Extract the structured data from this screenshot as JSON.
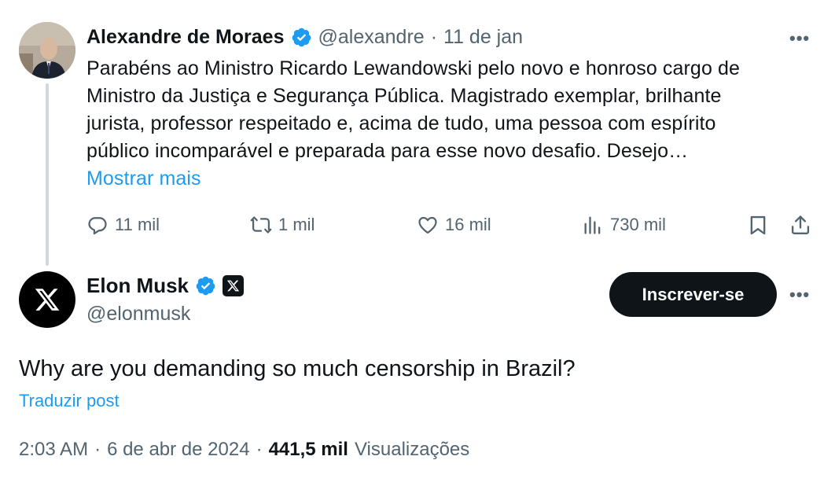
{
  "parent": {
    "author_name": "Alexandre de Moraes",
    "handle": "@alexandre",
    "separator": "·",
    "date": "11 de jan",
    "text_lines": [
      "Parabéns ao Ministro Ricardo Lewandowski pelo novo e honroso cargo de",
      "Ministro da Justiça e Segurança Pública. Magistrado exemplar, brilhante",
      "jurista, professor respeitado e, acima de tudo, uma pessoa com espírito",
      "público incomparável e preparada para esse novo desafio. Desejo…"
    ],
    "show_more": "Mostrar mais",
    "replies": "11 mil",
    "reposts": "1 mil",
    "likes": "16 mil",
    "views": "730 mil",
    "more_label": "•••"
  },
  "main": {
    "author_name": "Elon Musk",
    "handle": "@elonmusk",
    "subscribe_label": "Inscrever-se",
    "more_label": "•••",
    "text": "Why are you demanding so much censorship in Brazil?",
    "translate": "Traduzir post",
    "time": "2:03 AM",
    "date": "6 de abr de 2024",
    "sep1": "·",
    "sep2": "·",
    "views_count": "441,5 mil",
    "views_label": "Visualizações"
  },
  "colors": {
    "verified": "#1d9bf0",
    "link": "#1d9bf0",
    "muted": "#536471",
    "text": "#0f1419"
  },
  "icons": {
    "reply": "reply-icon",
    "repost": "repost-icon",
    "like": "heart-icon",
    "views": "views-icon",
    "bookmark": "bookmark-icon",
    "share": "share-icon"
  }
}
